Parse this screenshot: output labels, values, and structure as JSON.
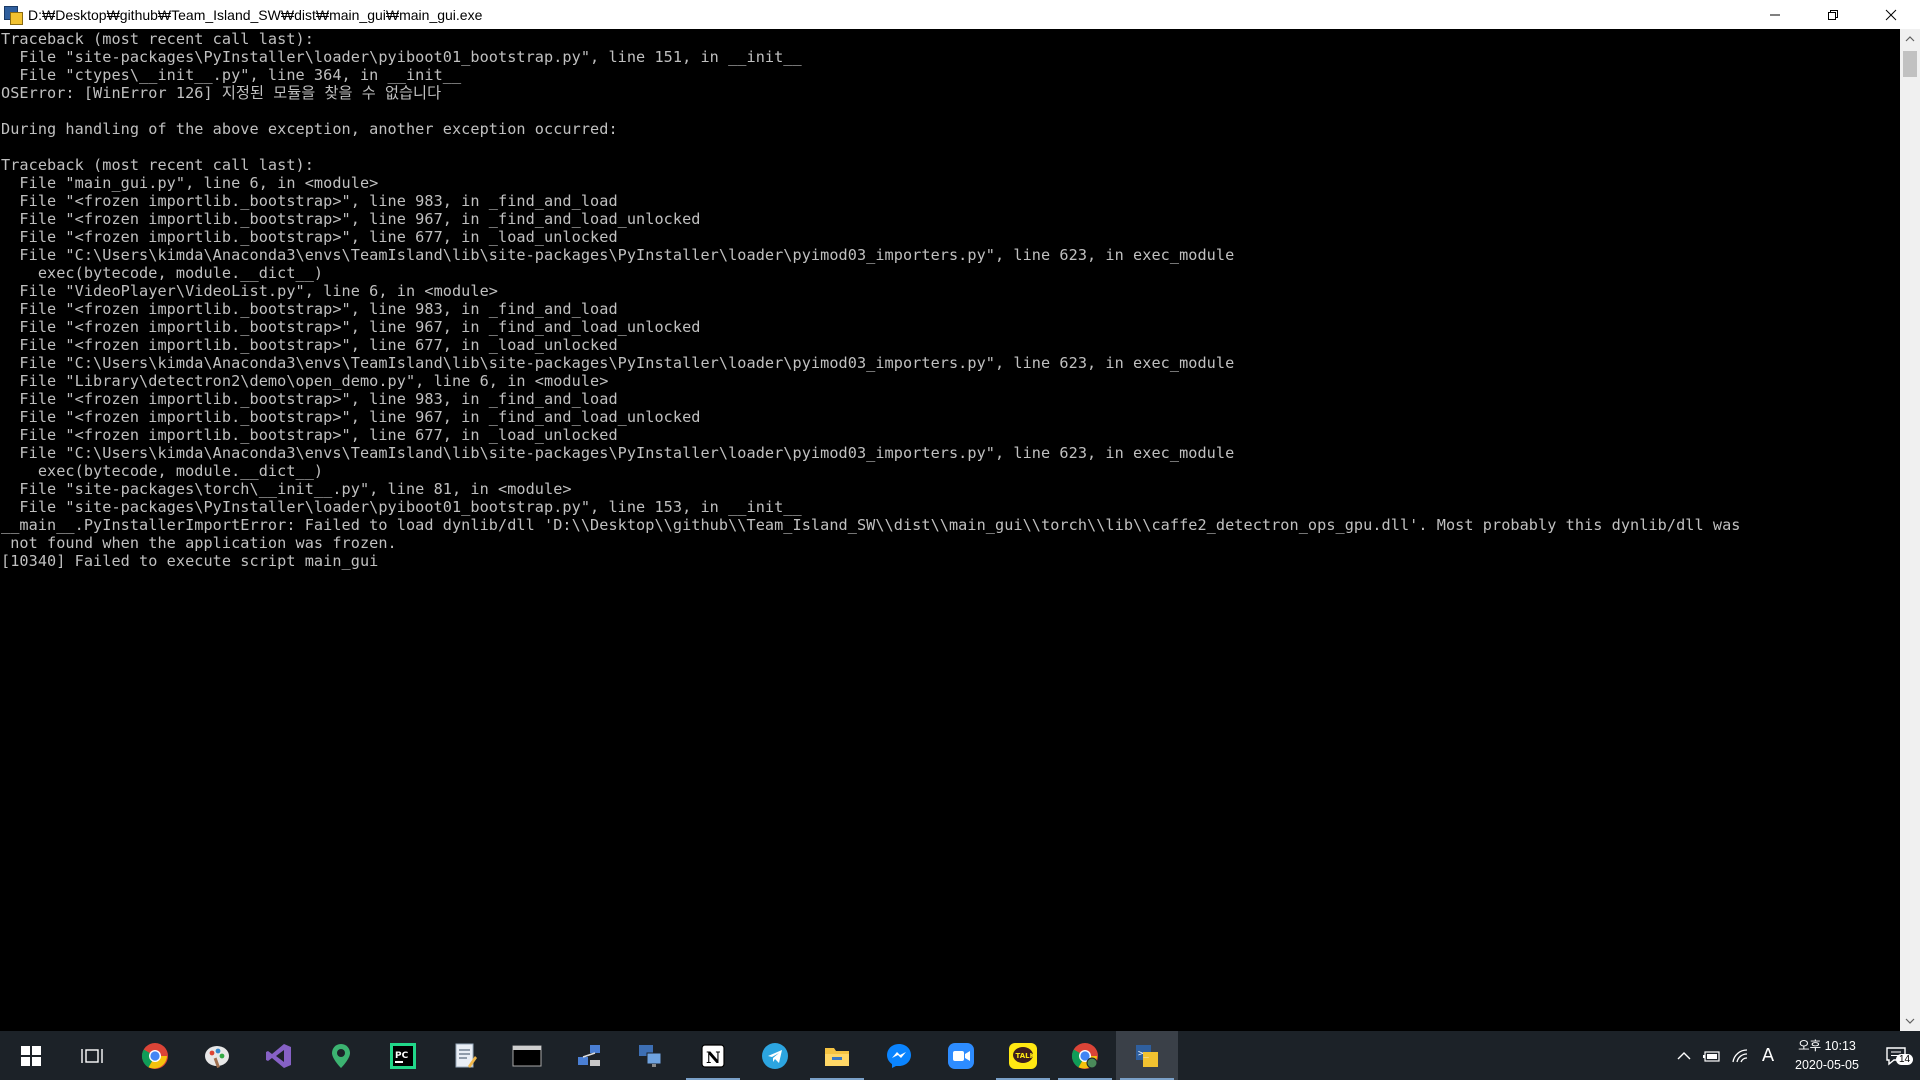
{
  "window": {
    "title": "D:₩Desktop₩github₩Team_Island_SW₩dist₩main_gui₩main_gui.exe",
    "minimize_icon": "minimize-icon",
    "maximize_icon": "restore-icon",
    "close_icon": "close-icon"
  },
  "console": {
    "lines": [
      "Traceback (most recent call last):",
      "  File \"site-packages\\PyInstaller\\loader\\pyiboot01_bootstrap.py\", line 151, in __init__",
      "  File \"ctypes\\__init__.py\", line 364, in __init__",
      "OSError: [WinError 126] 지정된 모듈을 찾을 수 없습니다",
      "",
      "During handling of the above exception, another exception occurred:",
      "",
      "Traceback (most recent call last):",
      "  File \"main_gui.py\", line 6, in <module>",
      "  File \"<frozen importlib._bootstrap>\", line 983, in _find_and_load",
      "  File \"<frozen importlib._bootstrap>\", line 967, in _find_and_load_unlocked",
      "  File \"<frozen importlib._bootstrap>\", line 677, in _load_unlocked",
      "  File \"C:\\Users\\kimda\\Anaconda3\\envs\\TeamIsland\\lib\\site-packages\\PyInstaller\\loader\\pyimod03_importers.py\", line 623, in exec_module",
      "    exec(bytecode, module.__dict__)",
      "  File \"VideoPlayer\\VideoList.py\", line 6, in <module>",
      "  File \"<frozen importlib._bootstrap>\", line 983, in _find_and_load",
      "  File \"<frozen importlib._bootstrap>\", line 967, in _find_and_load_unlocked",
      "  File \"<frozen importlib._bootstrap>\", line 677, in _load_unlocked",
      "  File \"C:\\Users\\kimda\\Anaconda3\\envs\\TeamIsland\\lib\\site-packages\\PyInstaller\\loader\\pyimod03_importers.py\", line 623, in exec_module",
      "  File \"Library\\detectron2\\demo\\open_demo.py\", line 6, in <module>",
      "  File \"<frozen importlib._bootstrap>\", line 983, in _find_and_load",
      "  File \"<frozen importlib._bootstrap>\", line 967, in _find_and_load_unlocked",
      "  File \"<frozen importlib._bootstrap>\", line 677, in _load_unlocked",
      "  File \"C:\\Users\\kimda\\Anaconda3\\envs\\TeamIsland\\lib\\site-packages\\PyInstaller\\loader\\pyimod03_importers.py\", line 623, in exec_module",
      "    exec(bytecode, module.__dict__)",
      "  File \"site-packages\\torch\\__init__.py\", line 81, in <module>",
      "  File \"site-packages\\PyInstaller\\loader\\pyiboot01_bootstrap.py\", line 153, in __init__",
      "__main__.PyInstallerImportError: Failed to load dynlib/dll 'D:\\\\Desktop\\\\github\\\\Team_Island_SW\\\\dist\\\\main_gui\\\\torch\\\\lib\\\\caffe2_detectron_ops_gpu.dll'. Most probably this dynlib/dll was",
      " not found when the application was frozen.",
      "[10340] Failed to execute script main_gui"
    ]
  },
  "scrollbar": {
    "up_icon": "scroll-up-arrow-icon",
    "down_icon": "scroll-down-arrow-icon"
  },
  "taskbar": {
    "items": [
      {
        "icon": "windows-start-icon",
        "active": false
      },
      {
        "icon": "task-view-icon",
        "active": false
      },
      {
        "icon": "chrome-icon",
        "active": false
      },
      {
        "icon": "paint-palette-icon",
        "active": false
      },
      {
        "icon": "visual-studio-icon",
        "active": false
      },
      {
        "icon": "map-pin-app-icon",
        "active": false
      },
      {
        "icon": "pycharm-icon",
        "active": false
      },
      {
        "icon": "notepad-doc-icon",
        "active": false
      },
      {
        "icon": "terminal-window-icon",
        "active": false
      },
      {
        "icon": "network-computer-icon",
        "active": false
      },
      {
        "icon": "remote-desktop-icon",
        "active": false
      },
      {
        "icon": "notion-icon",
        "active": false
      },
      {
        "icon": "telegram-icon",
        "active": false
      },
      {
        "icon": "file-explorer-icon",
        "active": false
      },
      {
        "icon": "messenger-icon",
        "active": false
      },
      {
        "icon": "zoom-icon",
        "active": false
      },
      {
        "icon": "kakaotalk-icon",
        "active": false
      },
      {
        "icon": "chrome-beta-icon",
        "active": false
      },
      {
        "icon": "python-app-icon",
        "active": true
      }
    ],
    "tray": {
      "ime_label": "A",
      "clock_time": "오후 10:13",
      "clock_date": "2020-05-05",
      "notification_count": "14"
    }
  }
}
